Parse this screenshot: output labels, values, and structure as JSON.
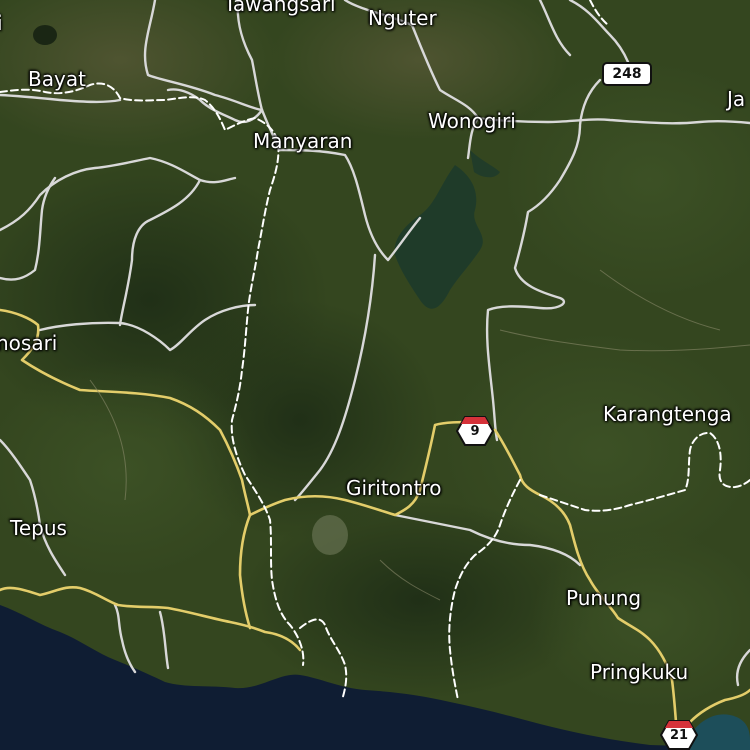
{
  "places": {
    "tawangsari": "Tawangsari",
    "nguter": "Nguter",
    "bayat": "Bayat",
    "jatisrono": "Ja",
    "wonogiri": "Wonogiri",
    "manyaran": "Manyaran",
    "wonosari": "nosari",
    "karangtengah": "Karangtenga",
    "giritontro": "Giritontro",
    "tepus": "Tepus",
    "punung": "Punung",
    "pringkuku": "Pringkuku",
    "partial_left": "i"
  },
  "shields": {
    "route_248": "248",
    "route_9": "9",
    "route_21": "21"
  },
  "colors": {
    "land": "#34461f",
    "forest_dark": "#26361a",
    "reservoir": "#1f3b2a",
    "sea": "#0f1d33",
    "road_white": "#d8d8d8",
    "road_yellow": "#e3cd6a",
    "boundary": "#ffffff",
    "shield_red": "#d6323a"
  }
}
